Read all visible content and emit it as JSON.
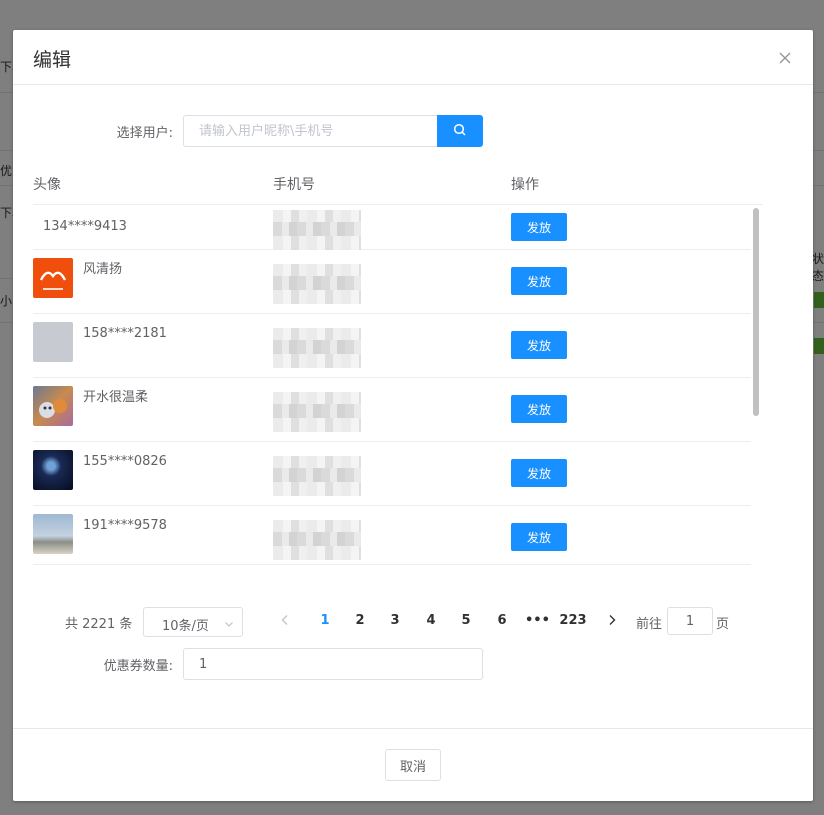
{
  "background": {
    "fragments": [
      "下单",
      "优惠",
      "下单",
      "小",
      "状态"
    ]
  },
  "dialog": {
    "title": "编辑",
    "search": {
      "label": "选择用户:",
      "placeholder": "请输入用户昵称\\手机号"
    },
    "table": {
      "headers": {
        "avatar": "头像",
        "phone": "手机号",
        "action": "操作"
      },
      "rows": [
        {
          "nickname": "134****9413",
          "avatar": "none",
          "action": "发放"
        },
        {
          "nickname": "风清扬",
          "avatar": "orange-logo",
          "action": "发放"
        },
        {
          "nickname": "158****2181",
          "avatar": "gray",
          "action": "发放"
        },
        {
          "nickname": "开水很温柔",
          "avatar": "cartoon",
          "action": "发放"
        },
        {
          "nickname": "155****0826",
          "avatar": "night-sky",
          "action": "发放"
        },
        {
          "nickname": "191****9578",
          "avatar": "beach",
          "action": "发放"
        }
      ]
    },
    "pagination": {
      "total_text": "共 2221 条",
      "page_size": "10条/页",
      "pages": [
        "1",
        "2",
        "3",
        "4",
        "5",
        "6",
        "•••",
        "223"
      ],
      "current_page": "1",
      "goto_label": "前往",
      "goto_value": "1",
      "goto_unit": "页"
    },
    "coupon": {
      "label": "优惠券数量:",
      "value": "1"
    },
    "footer": {
      "cancel": "取消"
    }
  },
  "colors": {
    "primary": "#1890ff",
    "border": "#dcdfe6"
  }
}
